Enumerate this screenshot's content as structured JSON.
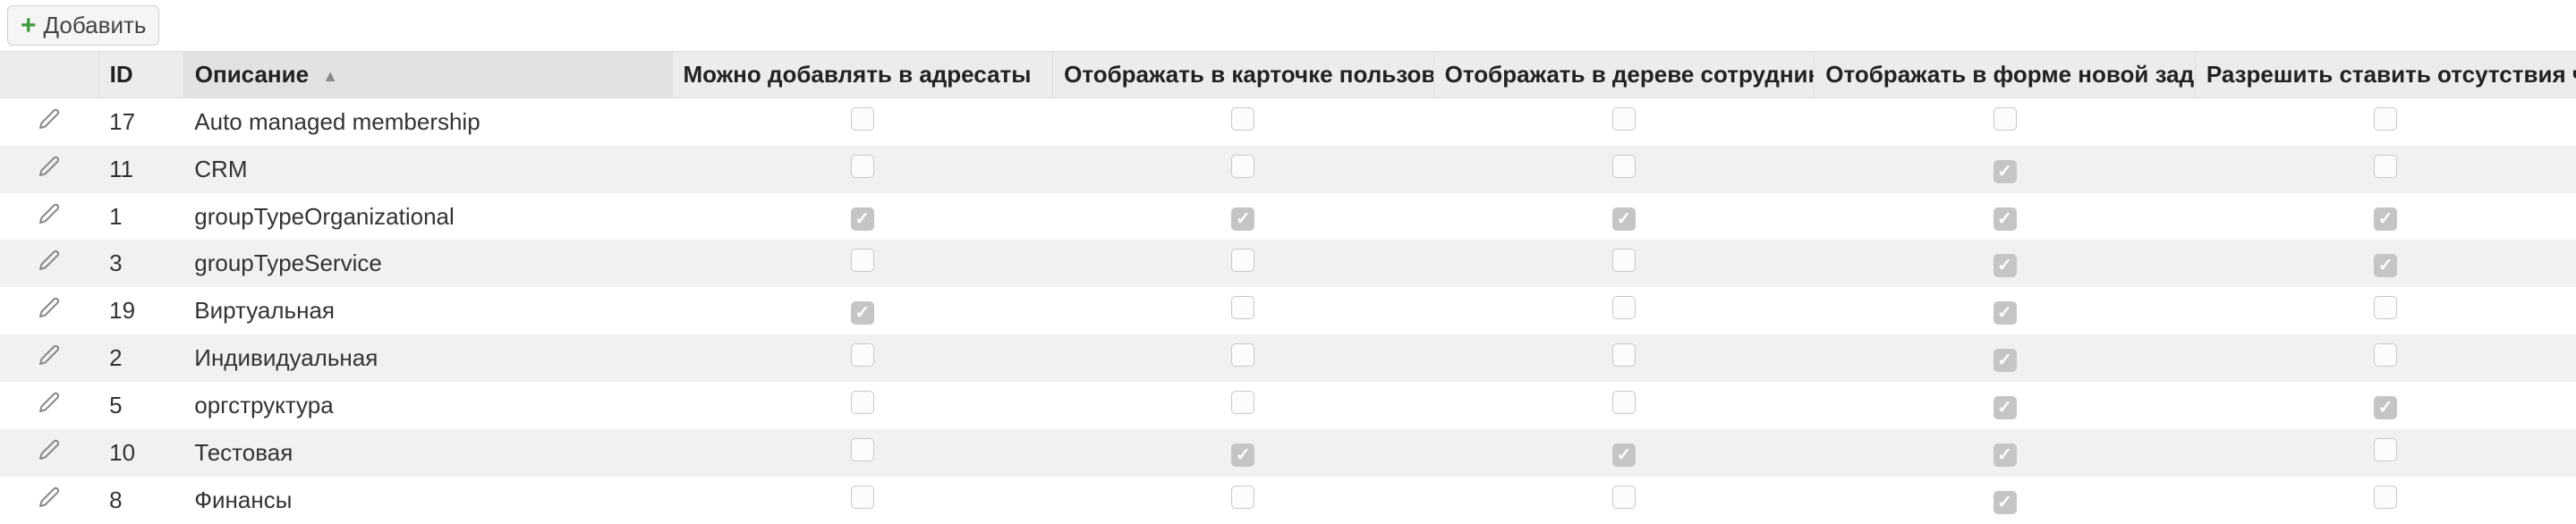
{
  "toolbar": {
    "add_label": "Добавить"
  },
  "columns": {
    "id": "ID",
    "description": "Описание",
    "can_add_recipients": "Можно добавлять в адресаты",
    "show_user_card": "Отображать в карточке пользователя",
    "show_employee_tree": "Отображать в дереве сотрудников",
    "show_new_task_form": "Отображать в форме новой задачи",
    "allow_absence_members": "Разрешить ставить отсутствия членам"
  },
  "rows": [
    {
      "id": "17",
      "description": "Auto managed membership",
      "c1": false,
      "c2": false,
      "c3": false,
      "c4": false,
      "c5": false
    },
    {
      "id": "11",
      "description": "CRM",
      "c1": false,
      "c2": false,
      "c3": false,
      "c4": true,
      "c5": false
    },
    {
      "id": "1",
      "description": "groupTypeOrganizational",
      "c1": true,
      "c2": true,
      "c3": true,
      "c4": true,
      "c5": true
    },
    {
      "id": "3",
      "description": "groupTypeService",
      "c1": false,
      "c2": false,
      "c3": false,
      "c4": true,
      "c5": true
    },
    {
      "id": "19",
      "description": "Виртуальная",
      "c1": true,
      "c2": false,
      "c3": false,
      "c4": true,
      "c5": false
    },
    {
      "id": "2",
      "description": "Индивидуальная",
      "c1": false,
      "c2": false,
      "c3": false,
      "c4": true,
      "c5": false
    },
    {
      "id": "5",
      "description": "оргструктура",
      "c1": false,
      "c2": false,
      "c3": false,
      "c4": true,
      "c5": true
    },
    {
      "id": "10",
      "description": "Тестовая",
      "c1": false,
      "c2": true,
      "c3": true,
      "c4": true,
      "c5": false
    },
    {
      "id": "8",
      "description": "Финансы",
      "c1": false,
      "c2": false,
      "c3": false,
      "c4": true,
      "c5": false
    }
  ]
}
